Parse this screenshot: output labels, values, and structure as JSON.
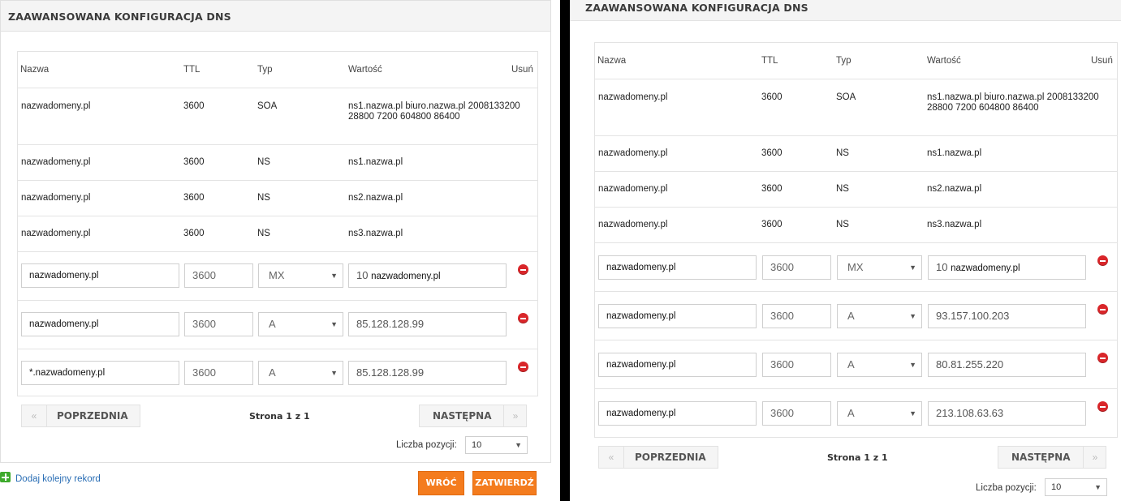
{
  "section_title": "ZAAWANSOWANA KONFIGURACJA DNS",
  "columns": {
    "name": "Nazwa",
    "ttl": "TTL",
    "type": "Typ",
    "value": "Wartość",
    "delete": "Usuń"
  },
  "static_records": [
    {
      "name": "nazwadomeny.pl",
      "ttl": "3600",
      "type": "SOA",
      "value": "ns1.nazwa.pl biuro.nazwa.pl 2008133200 28800 7200 604800 86400"
    },
    {
      "name": "nazwadomeny.pl",
      "ttl": "3600",
      "type": "NS",
      "value": "ns1.nazwa.pl"
    },
    {
      "name": "nazwadomeny.pl",
      "ttl": "3600",
      "type": "NS",
      "value": "ns2.nazwa.pl"
    },
    {
      "name": "nazwadomeny.pl",
      "ttl": "3600",
      "type": "NS",
      "value": "ns3.nazwa.pl"
    }
  ],
  "left": {
    "editable_records": [
      {
        "name": "nazwadomeny.pl",
        "ttl": "3600",
        "type": "MX",
        "priority": "10",
        "value": "nazwadomeny.pl"
      },
      {
        "name": "nazwadomeny.pl",
        "ttl": "3600",
        "type": "A",
        "value": "85.128.128.99"
      },
      {
        "name": "*.nazwadomeny.pl",
        "ttl": "3600",
        "type": "A",
        "value": "85.128.128.99"
      }
    ]
  },
  "right": {
    "editable_records": [
      {
        "name": "nazwadomeny.pl",
        "ttl": "3600",
        "type": "MX",
        "priority": "10",
        "value": "nazwadomeny.pl"
      },
      {
        "name": "nazwadomeny.pl",
        "ttl": "3600",
        "type": "A",
        "value": "93.157.100.203"
      },
      {
        "name": "nazwadomeny.pl",
        "ttl": "3600",
        "type": "A",
        "value": "80.81.255.220"
      },
      {
        "name": "nazwadomeny.pl",
        "ttl": "3600",
        "type": "A",
        "value": "213.108.63.63"
      }
    ]
  },
  "pagination": {
    "prev_label": "POPRZEDNIA",
    "next_label": "NASTĘPNA",
    "prev_icon": "«",
    "next_icon": "»",
    "page_info": "Strona 1 z 1",
    "per_page_label": "Liczba pozycji:",
    "per_page_value": "10"
  },
  "actions": {
    "add_record_label": "Dodaj kolejny rekord",
    "back_label": "WRÓĆ",
    "confirm_label": "ZATWIERDŹ"
  },
  "colors": {
    "accent": "#f47c1e",
    "delete": "#d9262a",
    "add": "#3eaa2c",
    "link": "#2a6eb5"
  }
}
